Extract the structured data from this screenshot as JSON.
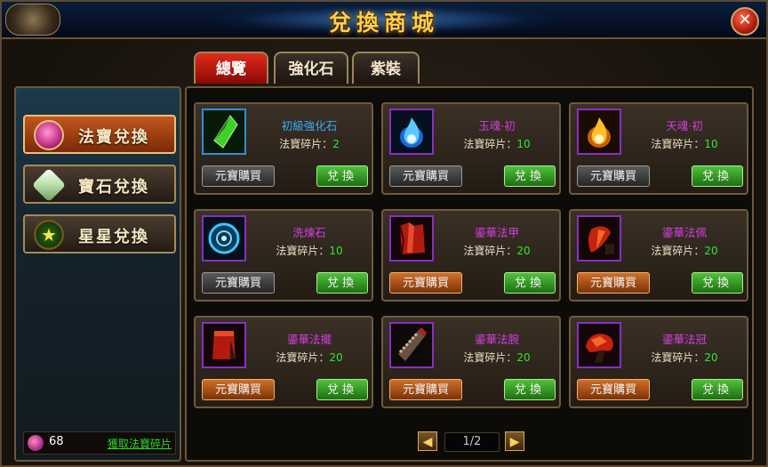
{
  "window": {
    "title": "兌換商城"
  },
  "tabs": [
    {
      "label": "總覽",
      "active": true
    },
    {
      "label": "強化石",
      "active": false
    },
    {
      "label": "紫裝",
      "active": false
    }
  ],
  "sidebar": {
    "items": [
      {
        "label": "法寶兌換",
        "icon": "treasure-bowl-icon",
        "active": true
      },
      {
        "label": "寶石兌換",
        "icon": "gem-crystal-icon",
        "active": false
      },
      {
        "label": "星星兌換",
        "icon": "star-medal-icon",
        "active": false
      }
    ],
    "fragments": {
      "count": "68",
      "link": "獲取法寶碎片"
    }
  },
  "items": [
    {
      "name": "初級強化石",
      "price_label": "法寶碎片：",
      "price": "2",
      "buy": "元寶購買",
      "exchange": "兌換",
      "quality": "blue",
      "buy_enabled": false,
      "icon": "green-crystal-icon"
    },
    {
      "name": "玉魂·初",
      "price_label": "法寶碎片：",
      "price": "10",
      "buy": "元寶購買",
      "exchange": "兌換",
      "quality": "purple",
      "buy_enabled": false,
      "icon": "blue-flame-icon"
    },
    {
      "name": "天魂·初",
      "price_label": "法寶碎片：",
      "price": "10",
      "buy": "元寶購買",
      "exchange": "兌換",
      "quality": "purple",
      "buy_enabled": false,
      "icon": "gold-flame-icon"
    },
    {
      "name": "洗煉石",
      "price_label": "法寶碎片：",
      "price": "10",
      "buy": "元寶購買",
      "exchange": "兌換",
      "quality": "purple",
      "buy_enabled": false,
      "icon": "blue-rune-stone-icon"
    },
    {
      "name": "鎏華法甲",
      "price_label": "法寶碎片：",
      "price": "20",
      "buy": "元寶購買",
      "exchange": "兌換",
      "quality": "purple",
      "buy_enabled": true,
      "icon": "red-armor-icon"
    },
    {
      "name": "鎏華法佩",
      "price_label": "法寶碎片：",
      "price": "20",
      "buy": "元寶購買",
      "exchange": "兌換",
      "quality": "purple",
      "buy_enabled": true,
      "icon": "red-pendant-icon"
    },
    {
      "name": "鎏華法擺",
      "price_label": "法寶碎片：",
      "price": "20",
      "buy": "元寶購買",
      "exchange": "兌換",
      "quality": "purple",
      "buy_enabled": true,
      "icon": "red-robe-icon"
    },
    {
      "name": "鎏華法腕",
      "price_label": "法寶碎片：",
      "price": "20",
      "buy": "元寶購買",
      "exchange": "兌換",
      "quality": "purple",
      "buy_enabled": true,
      "icon": "bracer-icon"
    },
    {
      "name": "鎏華法冠",
      "price_label": "法寶碎片：",
      "price": "20",
      "buy": "元寶購買",
      "exchange": "兌換",
      "quality": "purple",
      "buy_enabled": true,
      "icon": "red-crown-icon"
    }
  ],
  "pagination": {
    "page": "1/2",
    "prev": "◀",
    "next": "▶"
  },
  "colors": {
    "purple_quality": "#d43fe0",
    "blue_quality": "#3ab0ff",
    "price_value": "#2fe82f",
    "title_gold": "#ffcf4a"
  }
}
